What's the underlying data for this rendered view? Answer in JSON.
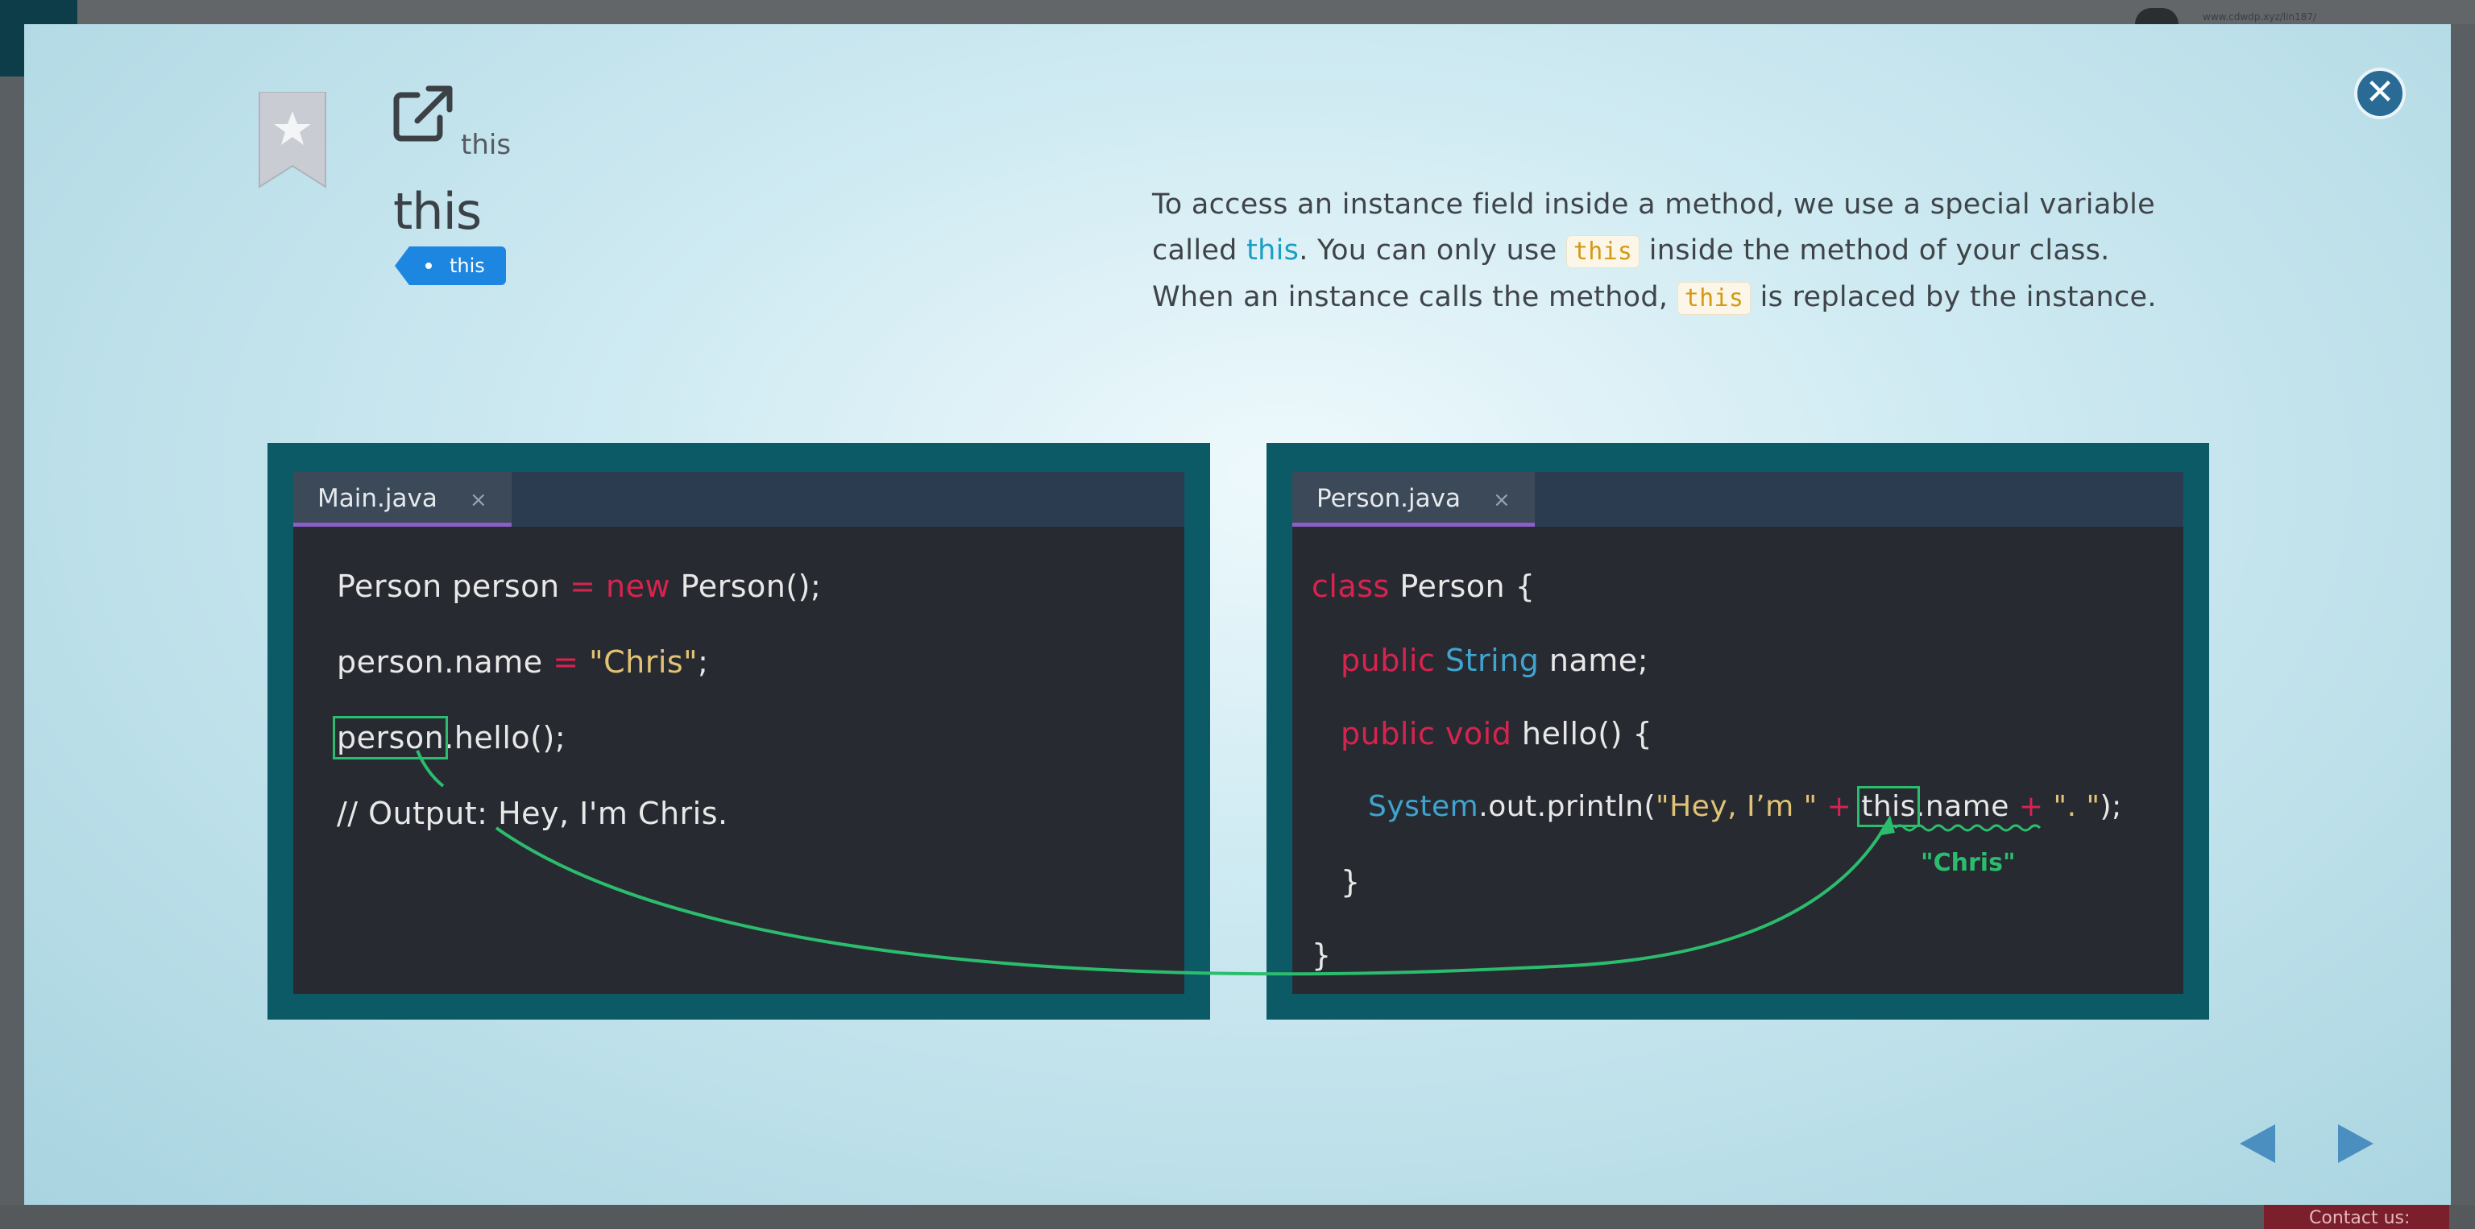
{
  "background": {
    "url_text": "www.cdwdp.xyz/lin187/"
  },
  "footer": {
    "contact_label": "Contact us:"
  },
  "card": {
    "small_title": "this",
    "title": "this",
    "tag_label": "this",
    "description": {
      "line1": "To access an instance field inside a method, we use a special variable",
      "line2_pre": "called ",
      "line2_kw": "this",
      "line2_mid": ". You can only use ",
      "line2_code": "this",
      "line2_post": " inside the method of your class.",
      "line3_pre": "When an instance calls the method, ",
      "line3_code": "this",
      "line3_post": " is replaced by the instance."
    }
  },
  "left_editor": {
    "tab_label": "Main.java",
    "tab_close": "×",
    "lines": {
      "l1a": "Person person ",
      "l1b": "=",
      "l1c": " new",
      "l1d": " Person();",
      "l2a": "person.name ",
      "l2b": "=",
      "l2c": " \"Chris\"",
      "l2d": ";",
      "l3a": "person",
      "l3b": ".hello();",
      "l4": "// Output: Hey, I'm Chris."
    }
  },
  "right_editor": {
    "tab_label": "Person.java",
    "tab_close": "×",
    "lines": {
      "l1a": "class",
      "l1b": " Person {",
      "l2a": "public",
      "l2b": " String",
      "l2c": " name;",
      "l3a": "public void",
      "l3b": " hello() {",
      "l4a": "System",
      "l4b": ".out.println(",
      "l4c": "\"Hey, I’m \"",
      "l4d": " +",
      "l4e": " ",
      "l4f": "this",
      "l4g": ".name",
      "l4h": " +",
      "l4i": " \". \"",
      "l4j": ");",
      "l5": "}",
      "l6": "}"
    },
    "annotation": "\"Chris\""
  },
  "colors": {
    "accent_green": "#2bbd6d",
    "keyword_red": "#d9234f",
    "type_blue": "#3fa4cf",
    "string_yellow": "#e2c274",
    "tag_blue": "#1d86e0"
  },
  "icons": [
    "bookmark-icon",
    "external-link-icon",
    "close-icon",
    "prev-arrow-icon",
    "next-arrow-icon"
  ]
}
